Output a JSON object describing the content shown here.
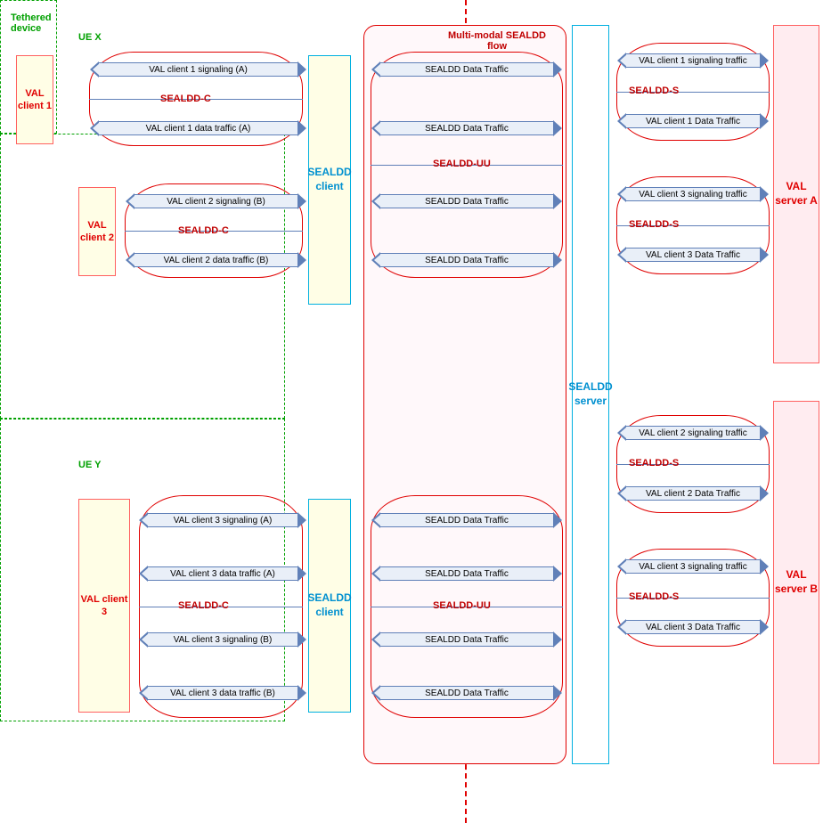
{
  "labels": {
    "tethered": "Tethered device",
    "uex": "UE X",
    "uey": "UE Y",
    "val_client_1": "VAL client 1",
    "val_client_2": "VAL client 2",
    "val_client_3": "VAL client 3",
    "sealdd_client": "SEALDD client",
    "sealdd_server": "SEALDD server",
    "val_server_a": "VAL server A",
    "val_server_b": "VAL server B",
    "multimodal": "Multi-modal SEALDD flow",
    "sealdd_c": "SEALDD-C",
    "sealdd_uu": "SEALDD-UU",
    "sealdd_s": "SEALDD-S"
  },
  "arrows": {
    "c1_sig_a": "VAL client 1 signaling (A)",
    "c1_data_a": "VAL client 1 data traffic (A)",
    "c2_sig_b": "VAL client 2 signaling (B)",
    "c2_data_b": "VAL client 2 data traffic (B)",
    "c3_sig_a": "VAL client 3 signaling (A)",
    "c3_data_a": "VAL client 3 data traffic (A)",
    "c3_sig_b": "VAL client 3 signaling (B)",
    "c3_data_b": "VAL client 3 data traffic (B)",
    "sealdd_traffic": "SEALDD Data Traffic",
    "s_c1_sig": "VAL client 1 signaling traffic",
    "s_c1_data": "VAL client 1 Data Traffic",
    "s_c2_sig": "VAL client 2 signaling traffic",
    "s_c2_data": "VAL client 2 Data Traffic",
    "s_c3_sig": "VAL client 3 signaling traffic",
    "s_c3_data": "VAL client 3 Data Traffic"
  }
}
